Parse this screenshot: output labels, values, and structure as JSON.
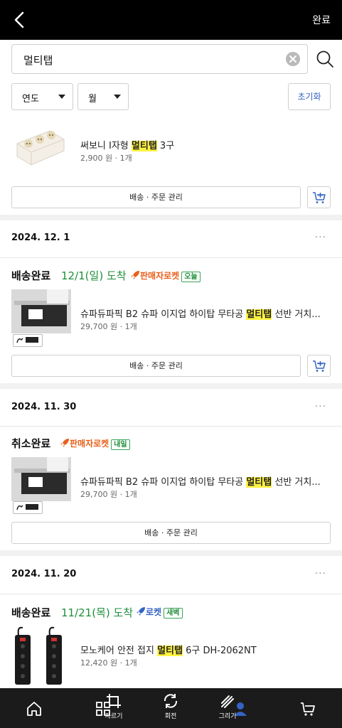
{
  "header": {
    "done_label": "완료"
  },
  "search": {
    "value": "멀티탭"
  },
  "filters": {
    "year_label": "연도",
    "month_label": "월",
    "reset_label": "초기화"
  },
  "top_product": {
    "title_before": "써보니 I자형 ",
    "title_highlight": "멀티탭",
    "title_after": " 3구",
    "meta": "2,900 원 · 1개",
    "manage_label": "배송 · 주문 관리"
  },
  "orders": [
    {
      "date": "2024. 12. 1",
      "status": "배송완료",
      "arrival": "12/1(일) 도착",
      "rocket": "판매자로켓",
      "rocket_badge": "오늘",
      "title_before": "슈파듀파픽 B2 슈파 이지업 하이탑 무타공 ",
      "title_highlight": "멀티탭",
      "title_after": " 선반 거치...",
      "meta": "29,700 원 · 1개",
      "manage_label": "배송 · 주문 관리"
    },
    {
      "date": "2024. 11. 30",
      "status": "취소완료",
      "arrival": "",
      "rocket": "판매자로켓",
      "rocket_badge": "내일",
      "title_before": "슈파듀파픽 B2 슈파 이지업 하이탑 무타공 ",
      "title_highlight": "멀티탭",
      "title_after": " 선반 거치...",
      "meta": "29,700 원 · 1개",
      "manage_label": "배송 · 주문 관리"
    },
    {
      "date": "2024. 11. 20",
      "status": "배송완료",
      "arrival": "11/21(목) 도착",
      "rocket": "로켓",
      "rocket_badge": "새벽",
      "title_before": "모노케어 안전 접지 ",
      "title_highlight": "멀티탭",
      "title_after": " 6구 DH-2062NT",
      "meta": "12,420 원 · 1개"
    }
  ],
  "more_label": "···",
  "toolbar": {
    "crop_label": "자르기",
    "rotate_label": "회전",
    "draw_label": "그리기"
  },
  "colors": {
    "highlight": "#fff341",
    "arrival_green": "#1e8f3a",
    "rocket_orange": "#e8601c",
    "rocket_blue": "#3463c5"
  }
}
